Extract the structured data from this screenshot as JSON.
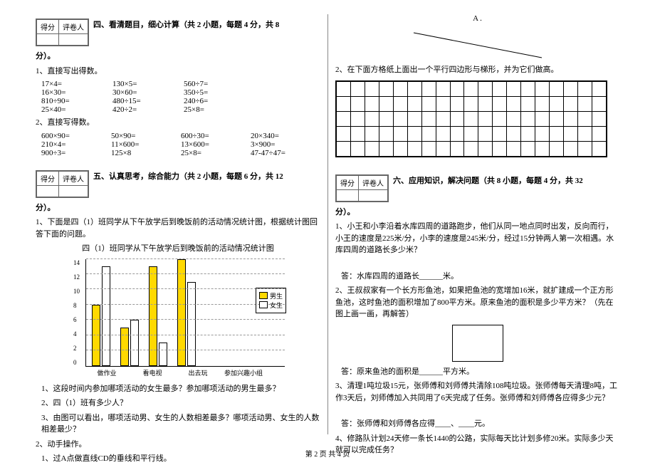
{
  "score_labels": {
    "score": "得分",
    "reviewer": "评卷人"
  },
  "section4": {
    "title": "四、看清题目，细心计算（共 2 小题，每题 4 分，共 8",
    "title_tail": "分）。",
    "q1_label": "1、直接写出得数。",
    "q1_rows": [
      [
        "17×4=",
        "130×5=",
        "560÷7="
      ],
      [
        "16×30=",
        "30×60=",
        "350÷5="
      ],
      [
        "810÷90=",
        "480÷15=",
        "240÷6="
      ],
      [
        "25×40=",
        "420÷2=",
        "25×8="
      ]
    ],
    "q2_label": "2、直接写得数。",
    "q2_rows": [
      [
        "600×90=",
        "50×90=",
        "600÷30=",
        "20×340="
      ],
      [
        "210×4=",
        "11×600=",
        "13×600=",
        "3×900="
      ],
      [
        "900÷3=",
        "125×8",
        "25×8=",
        "47-47÷47="
      ]
    ]
  },
  "section5": {
    "title": "五、认真思考，综合能力（共 2 小题，每题 6 分，共 12",
    "title_tail": "分）。",
    "q1": "1、下面是四（1）班同学从下午放学后到晚饭前的活动情况统计图，根据统计图回答下面的问题。",
    "chart_title": "四（1）班同学从下午放学后到晚饭前的活动情况统计图",
    "sub1": "1、这段时间内参加哪项活动的女生最多？参加哪项活动的男生最多？",
    "sub2": "2、四（1）班有多少人？",
    "sub3": "3、由图可以看出，哪项活动男、女生的人数相差最多？哪项活动男、女生的人数相差最少？",
    "q2": "2、动手操作。",
    "q2_sub": "1、过A点做直线CD的垂线和平行线。"
  },
  "right_top": {
    "a_label": "A ."
  },
  "grid_q": "2、在下面方格纸上面出一个平行四边形与梯形，并为它们做高。",
  "section6": {
    "title": "六、应用知识，解决问题（共 8 小题，每题 4 分，共 32",
    "title_tail": "分）。",
    "q1": "1、小王和小李沿着水库四周的道路跑步，他们从同一地点同时出发，反向而行，小王的速度是225米/分，小李的速度是245米/分，经过15分钟两人第一次相遇。水库四周的道路长多少米？",
    "ans1": "答：水库四周的道路长______米。",
    "q2": "2、王叔叔家有一个长方形鱼池，如果把鱼池的宽增加16米，就扩建成一个正方形鱼池，这时鱼池的面积增加了800平方米。原来鱼池的面积是多少平方米？（先在图上画一画，再解答）",
    "ans2": "答：原来鱼池的面积是______平方米。",
    "q3": "3、清理1吨垃圾15元，张师傅和刘师傅共清除108吨垃圾。张师傅每天清理8吨，工作3天后，刘师傅加入共同用了6天完成了任务。张师傅和刘师傅各应得多少元？",
    "ans3": "答：张师傅和刘师傅各应得____、____元。",
    "q4": "4、修路队计划24天修一条长1440的公路，实际每天比计划多修20米。实际多少天就可以完成任务？"
  },
  "footer": "第 2 页  共 4 页",
  "chart_data": {
    "type": "bar",
    "title": "四（1）班同学从下午放学后到晚饭前的活动情况统计图",
    "categories": [
      "做作业",
      "看电视",
      "出去玩",
      "参加兴趣小组"
    ],
    "series": [
      {
        "name": "男生",
        "values": [
          8,
          5,
          13,
          14
        ],
        "color": "#ffd900"
      },
      {
        "name": "女生",
        "values": [
          13,
          6,
          3,
          11
        ],
        "color": "#ffffff"
      }
    ],
    "ylim": [
      0,
      14
    ],
    "yticks": [
      0,
      2,
      4,
      6,
      8,
      10,
      12,
      14
    ],
    "legend": [
      "男生",
      "女生"
    ]
  }
}
